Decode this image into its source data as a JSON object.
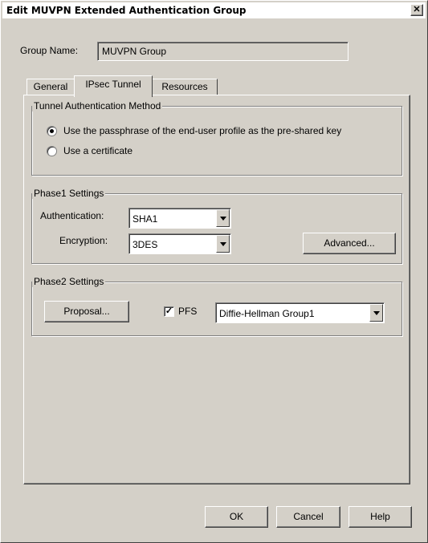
{
  "window": {
    "title": "Edit MUVPN Extended Authentication Group",
    "close_glyph": "✕"
  },
  "group_name": {
    "label": "Group Name:",
    "value": "MUVPN Group"
  },
  "tabs": [
    {
      "label": "General"
    },
    {
      "label": "IPsec Tunnel",
      "active": true
    },
    {
      "label": "Resources"
    }
  ],
  "tunnel_auth": {
    "legend": "Tunnel Authentication Method",
    "option_passphrase": "Use the passphrase of the end-user profile as the pre-shared key",
    "option_certificate": "Use a certificate",
    "selected": "passphrase"
  },
  "phase1": {
    "legend": "Phase1 Settings",
    "auth_label": "Authentication:",
    "auth_value": "SHA1",
    "enc_label": "Encryption:",
    "enc_value": "3DES",
    "advanced_label": "Advanced..."
  },
  "phase2": {
    "legend": "Phase2 Settings",
    "proposal_label": "Proposal...",
    "pfs_label": "PFS",
    "pfs_checked": true,
    "pfs_mark": "✓",
    "dh_value": "Diffie-Hellman Group1"
  },
  "footer": {
    "ok_label": "OK",
    "cancel_label": "Cancel",
    "help_label": "Help"
  }
}
